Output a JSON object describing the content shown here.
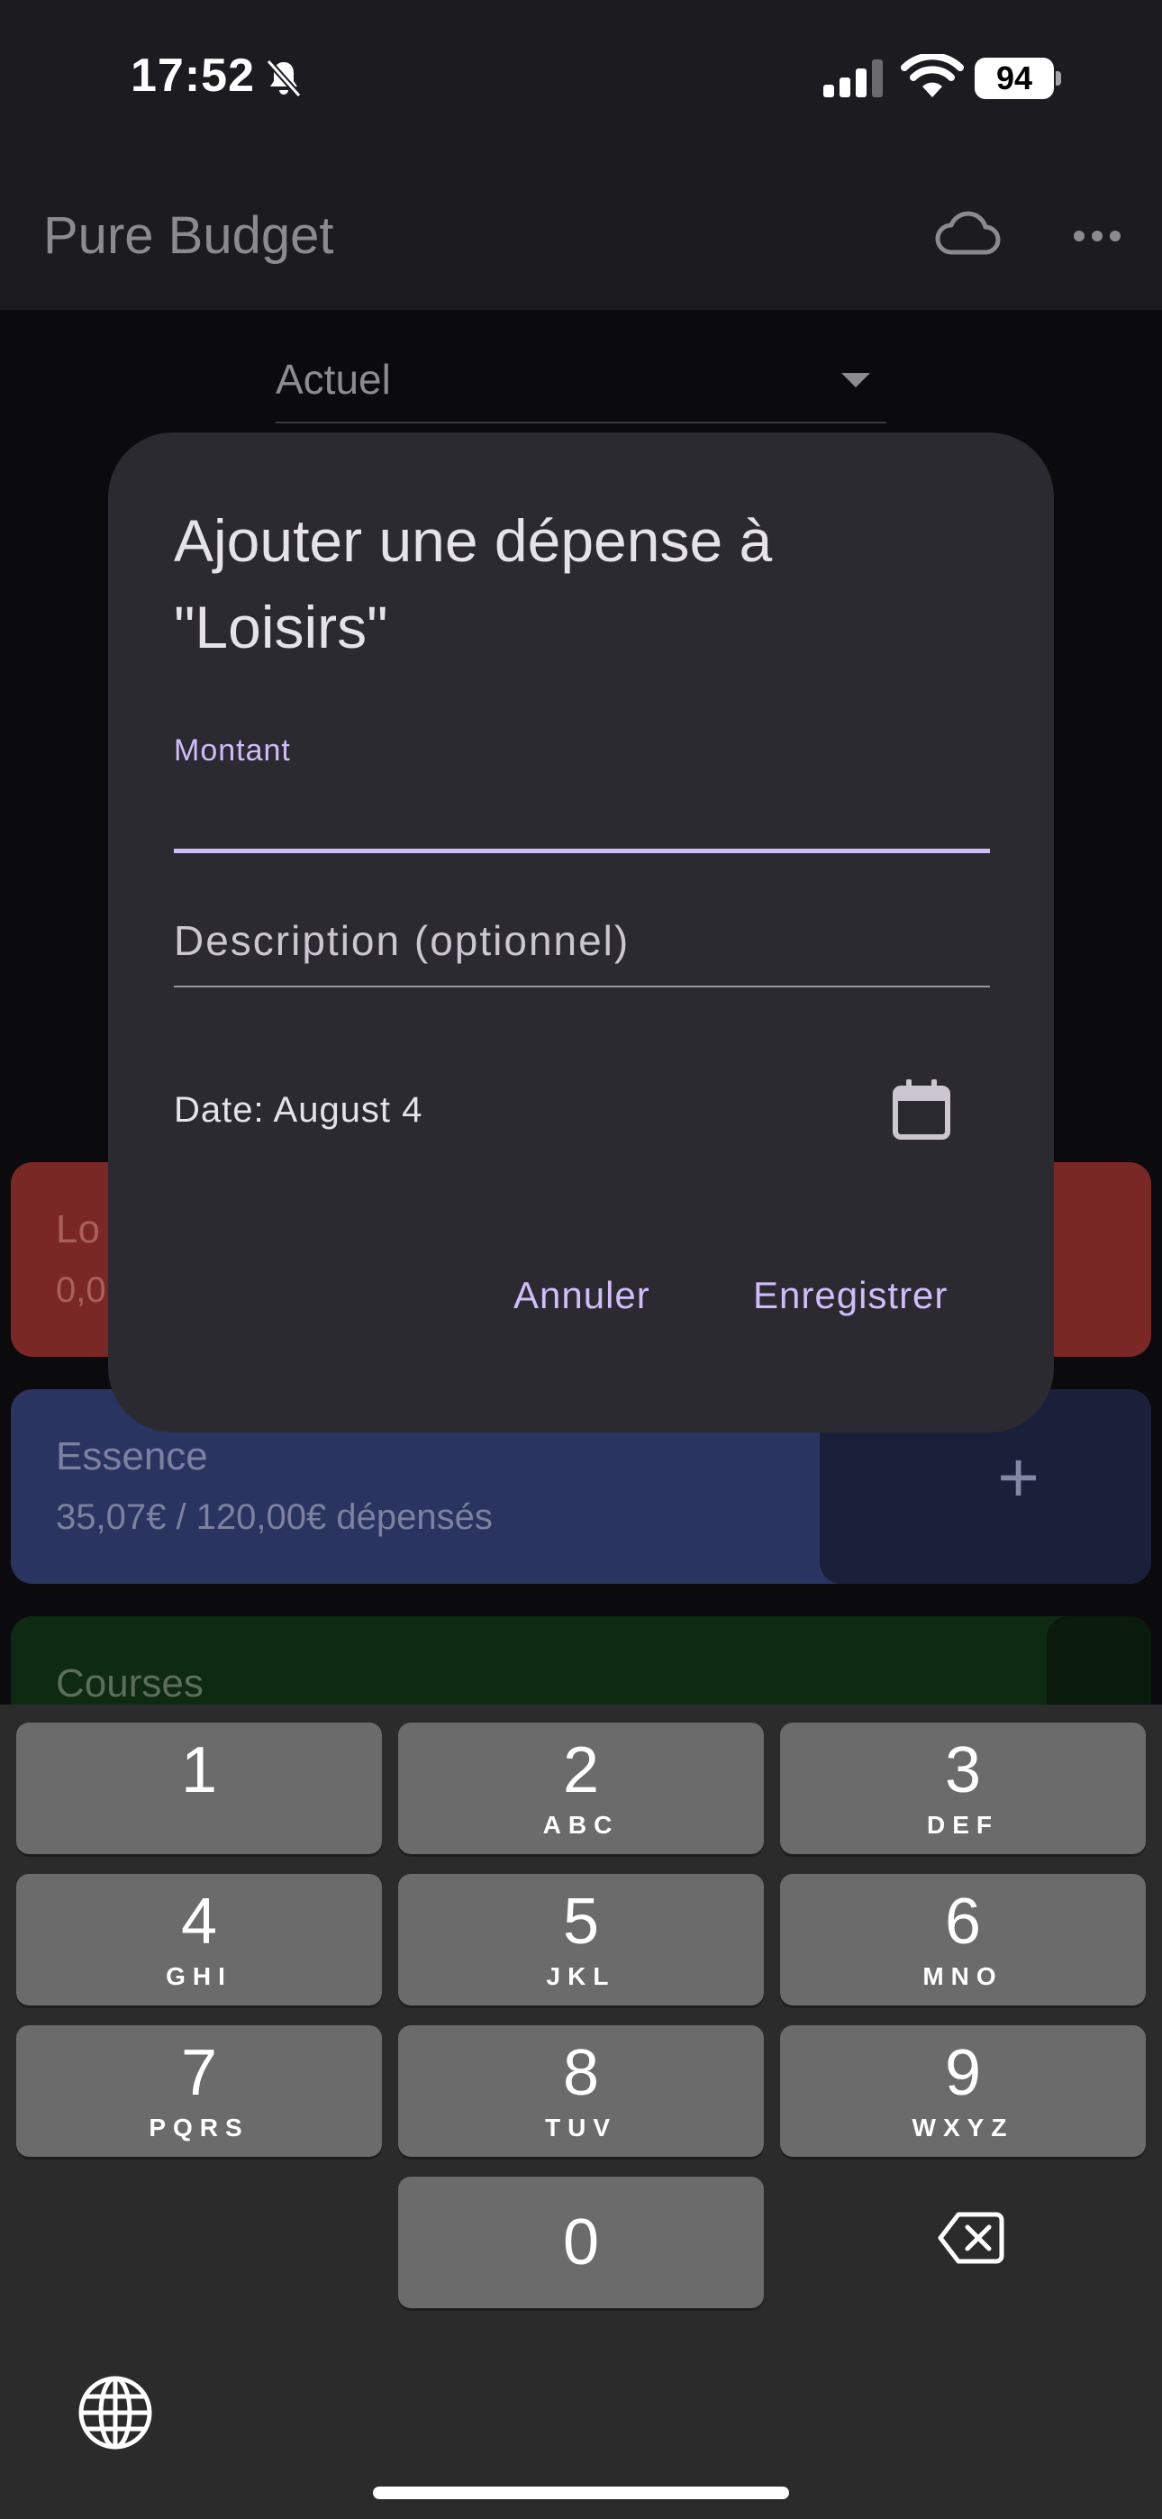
{
  "status_bar": {
    "time": "17:52",
    "battery": "94"
  },
  "app_bar": {
    "title": "Pure Budget"
  },
  "period_select": {
    "value": "Actuel"
  },
  "categories": [
    {
      "name": "Lo",
      "spent": "0,0"
    },
    {
      "name": "Essence",
      "spent": "35,07€ / 120,00€ dépensés",
      "add": "+"
    },
    {
      "name": "Courses",
      "add": "+"
    }
  ],
  "dialog": {
    "title": "Ajouter une dépense à \"Loisirs\"",
    "amount_label": "Montant",
    "amount_value": "",
    "description_placeholder": "Description (optionnel)",
    "date_label": "Date: August 4",
    "cancel_label": "Annuler",
    "save_label": "Enregistrer"
  },
  "keypad": {
    "keys": [
      {
        "digit": "1",
        "letters": ""
      },
      {
        "digit": "2",
        "letters": "ABC"
      },
      {
        "digit": "3",
        "letters": "DEF"
      },
      {
        "digit": "4",
        "letters": "GHI"
      },
      {
        "digit": "5",
        "letters": "JKL"
      },
      {
        "digit": "6",
        "letters": "MNO"
      },
      {
        "digit": "7",
        "letters": "PQRS"
      },
      {
        "digit": "8",
        "letters": "TUV"
      },
      {
        "digit": "9",
        "letters": "WXYZ"
      },
      {
        "digit": "0",
        "letters": ""
      }
    ]
  },
  "colors": {
    "accent": "#cfbdfa",
    "dialog_bg": "#2b2a31",
    "loisirs": "#7a2826",
    "essence": "#2a3460",
    "courses": "#0f2a12"
  }
}
